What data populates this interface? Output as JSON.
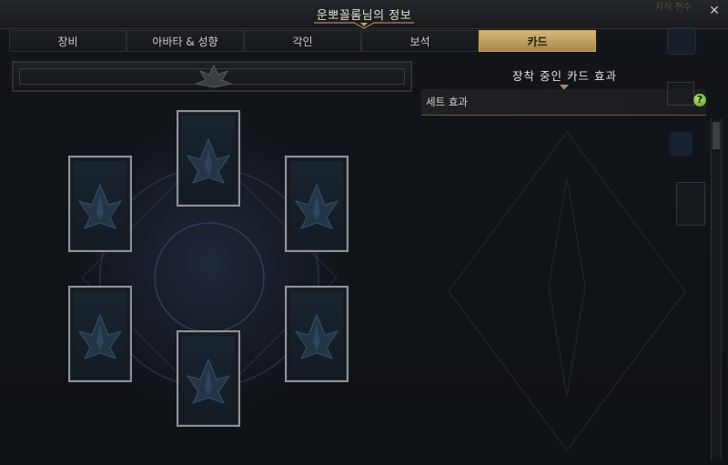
{
  "window": {
    "title": "운뽀꼴롬님의 정보",
    "close_symbol": "✕",
    "background_partial_label": "지식 전수"
  },
  "tabs": [
    {
      "label": "장비",
      "active": false
    },
    {
      "label": "아바타 & 성향",
      "active": false
    },
    {
      "label": "각인",
      "active": false
    },
    {
      "label": "보석",
      "active": false
    },
    {
      "label": "카드",
      "active": true
    }
  ],
  "card_slots": [
    {
      "slot": "top",
      "state": "empty"
    },
    {
      "slot": "upper-left",
      "state": "empty"
    },
    {
      "slot": "upper-right",
      "state": "empty"
    },
    {
      "slot": "lower-left",
      "state": "empty"
    },
    {
      "slot": "lower-right",
      "state": "empty"
    },
    {
      "slot": "bottom",
      "state": "empty"
    }
  ],
  "right_panel": {
    "title": "장착 중인 카드 효과",
    "set_effect_label": "세트 효과",
    "help_symbol": "?"
  },
  "colors": {
    "accent_gold": "#c8a460",
    "active_tab": "#d6b77a",
    "help_green": "#7cc23a",
    "card_border": "#8f9399"
  }
}
